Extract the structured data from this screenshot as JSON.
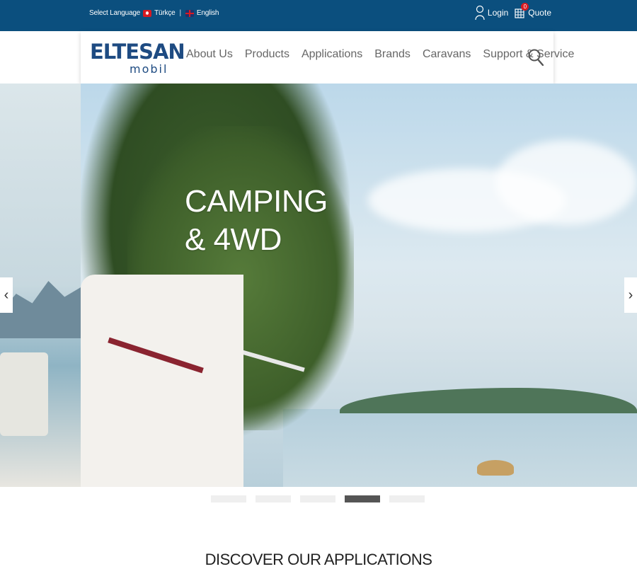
{
  "topbar": {
    "select_language": "Select Language",
    "lang_tr": "Türkçe",
    "divider": "|",
    "lang_en": "English",
    "login": "Login",
    "quote": "Quote",
    "quote_count": "0"
  },
  "logo": {
    "main": "ELTESAN",
    "sub": "mobil"
  },
  "nav": {
    "items": [
      "About Us",
      "Products",
      "Applications",
      "Brands",
      "Caravans",
      "Support & Service"
    ]
  },
  "hero": {
    "title": "CAMPING\n& 4WD",
    "prev": "‹",
    "next": "›"
  },
  "carousel": {
    "active_index": 3,
    "count": 5
  },
  "section": {
    "title": "DISCOVER OUR APPLICATIONS"
  },
  "colors": {
    "topbar": "#0b4f7e",
    "logo": "#1e4b82"
  },
  "icons": [
    "user-icon",
    "cart-icon",
    "search-icon",
    "chevron-left-icon",
    "chevron-right-icon",
    "turkey-flag-icon",
    "uk-flag-icon"
  ]
}
